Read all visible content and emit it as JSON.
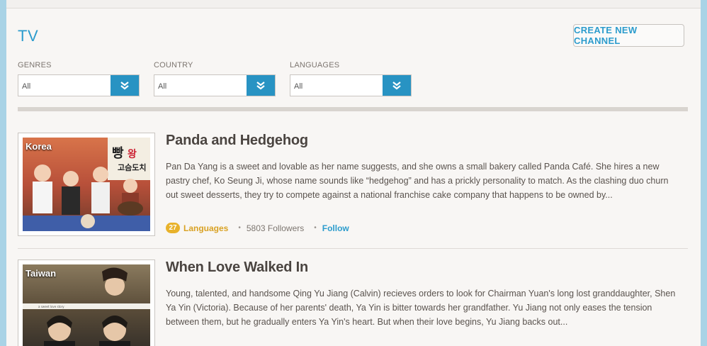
{
  "page": {
    "title": "TV",
    "create_button": "CREATE NEW CHANNEL"
  },
  "filters": [
    {
      "label": "GENRES",
      "value": "All"
    },
    {
      "label": "COUNTRY",
      "value": "All"
    },
    {
      "label": "LANGUAGES",
      "value": "All"
    }
  ],
  "items": [
    {
      "country": "Korea",
      "title": "Panda and Hedgehog",
      "description": "Pan Da Yang is a sweet and lovable as her name suggests, and she owns a small bakery called Panda Café. She hires a new pastry chef, Ko Seung Ji, whose name sounds like “hedgehog” and has a prickly personality to match. As the clashing duo churn out sweet desserts, they try to compete against a national franchise cake company that happens to be owned by...",
      "languages_count": "27",
      "languages_label": "Languages",
      "followers": "5803 Followers",
      "follow_label": "Follow"
    },
    {
      "country": "Taiwan",
      "title": "When Love Walked In",
      "description": "Young, talented, and handsome Qing Yu Jiang (Calvin) recieves orders to look for Chairman Yuan's long lost granddaughter, Shen Ya Yin (Victoria). Because of her parents' death, Ya Yin is bitter towards her grandfather. Yu Jiang not only eases the tension between them, but he gradually enters Ya Yin's heart. But when their love begins, Yu Jiang backs out..."
    }
  ],
  "colors": {
    "accent": "#2c9ccd",
    "select_button": "#2893c3",
    "badge": "#e8b22b"
  },
  "icons": {
    "select": "double-chevron-down-icon"
  }
}
